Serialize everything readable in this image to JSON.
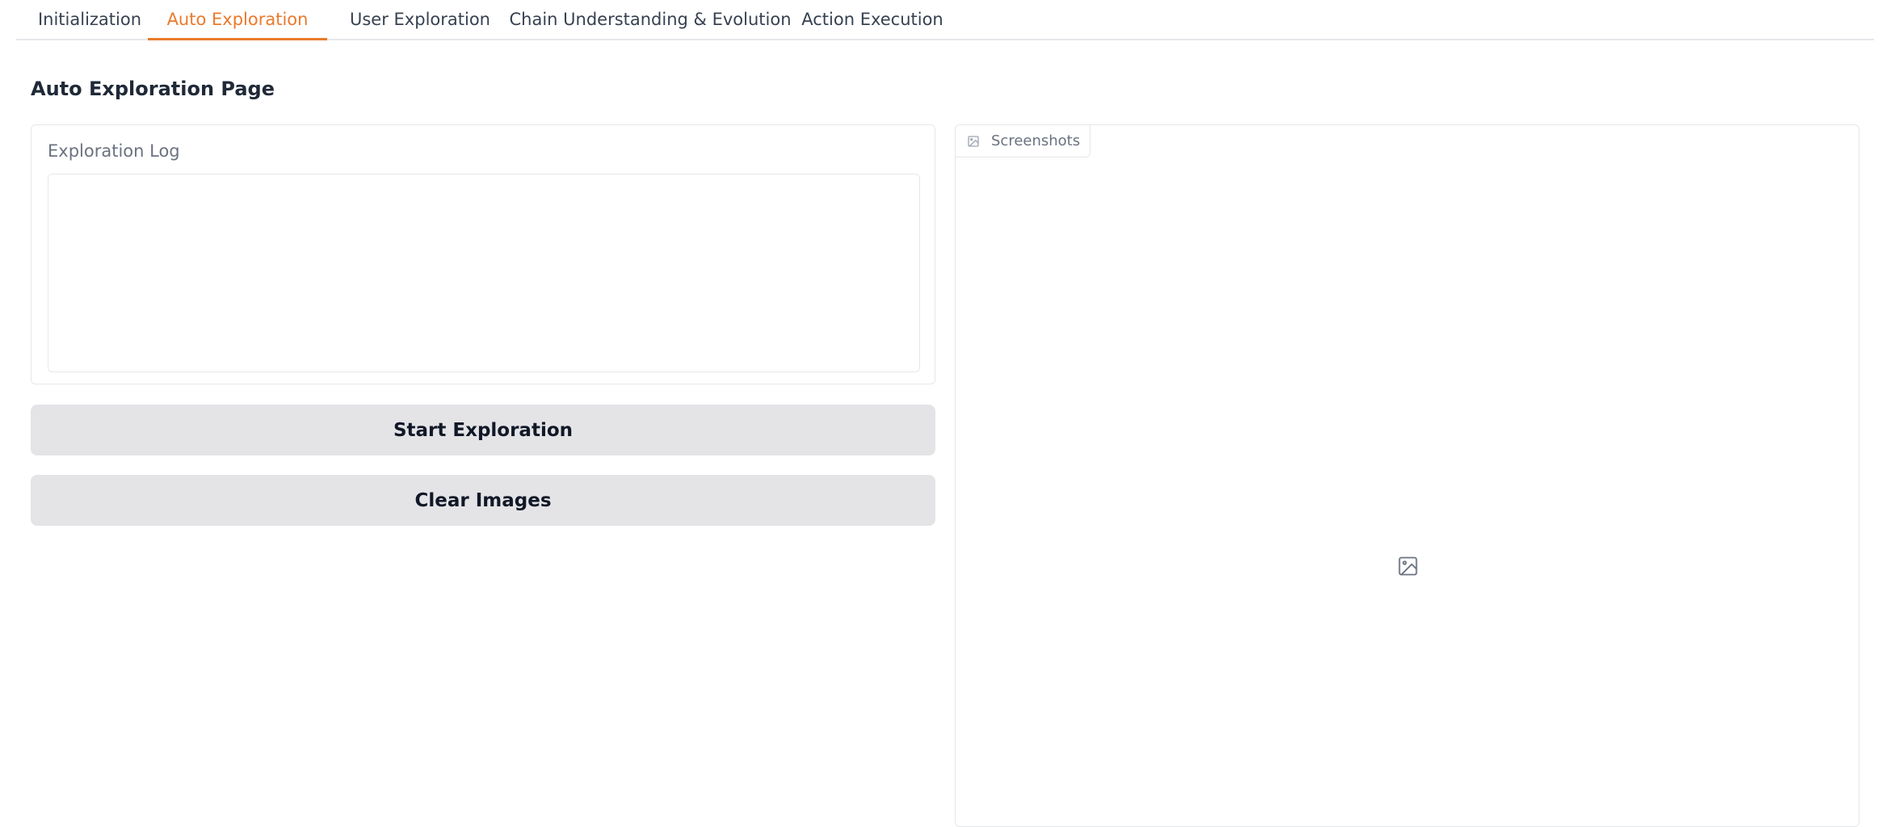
{
  "tabs": [
    {
      "label": "Initialization"
    },
    {
      "label": "Auto Exploration",
      "active": true
    },
    {
      "label": "User Exploration"
    },
    {
      "label": "Chain Understanding & Evolution"
    },
    {
      "label": "Action Execution"
    }
  ],
  "page": {
    "title": "Auto Exploration Page"
  },
  "log": {
    "label": "Exploration Log",
    "value": ""
  },
  "buttons": {
    "start": "Start Exploration",
    "clear": "Clear Images"
  },
  "gallery": {
    "label": "Screenshots",
    "label_icon": "image-icon",
    "placeholder_icon": "image-icon"
  },
  "colors": {
    "accent": "#ea7a2b",
    "button_bg": "#e4e4e7",
    "border": "#e5e7eb"
  }
}
